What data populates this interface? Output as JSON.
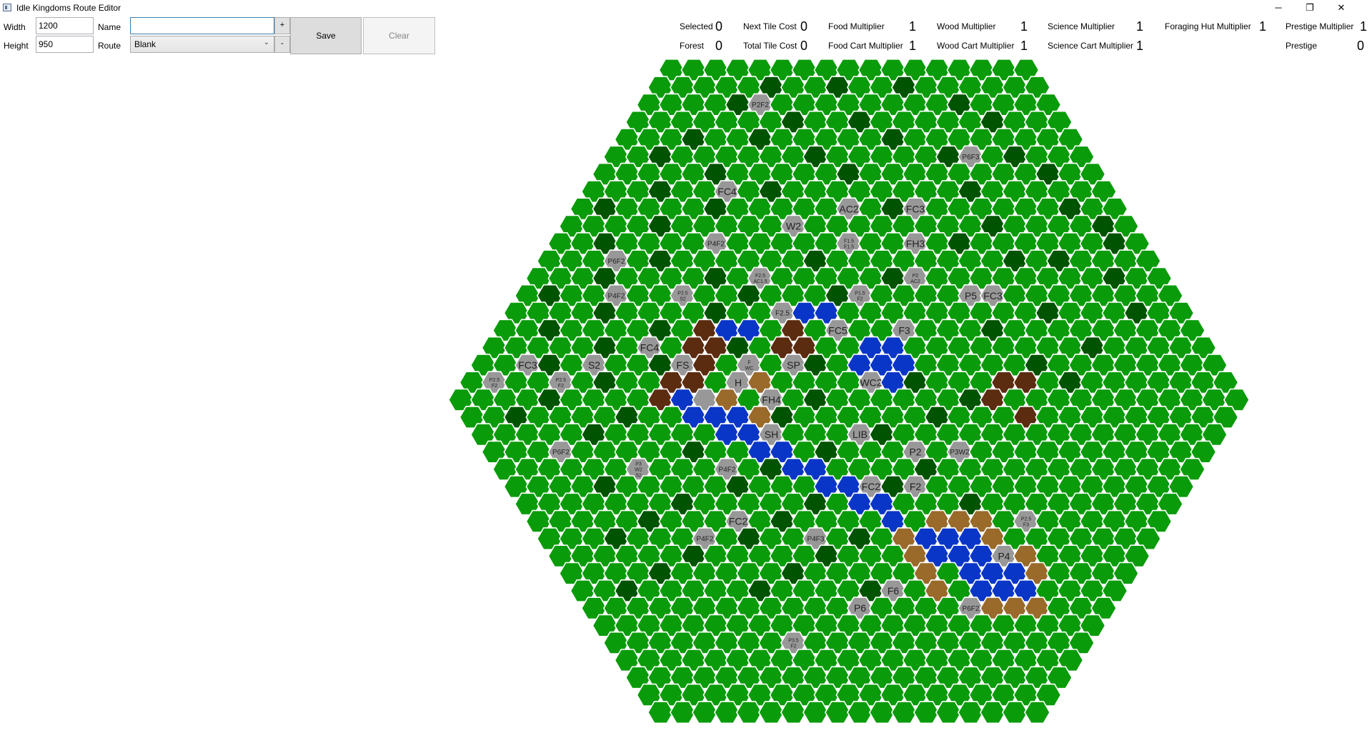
{
  "window": {
    "title": "Idle Kingdoms Route Editor",
    "minimize": "─",
    "restore": "❐",
    "close": "✕"
  },
  "toolbar": {
    "width_label": "Width",
    "width_value": "1200",
    "height_label": "Height",
    "height_value": "950",
    "name_label": "Name",
    "name_value": "",
    "route_label": "Route",
    "route_value": "Blank",
    "add_label": "+",
    "remove_label": "-",
    "save_label": "Save",
    "clear_label": "Clear"
  },
  "stats": {
    "selected": {
      "label": "Selected",
      "value": "0"
    },
    "forest": {
      "label": "Forest",
      "value": "0"
    },
    "next_tile_cost": {
      "label": "Next Tile Cost",
      "value": "0"
    },
    "total_tile_cost": {
      "label": "Total Tile Cost",
      "value": "0"
    },
    "food_multiplier": {
      "label": "Food Multiplier",
      "value": "1"
    },
    "food_cart_multiplier": {
      "label": "Food Cart Multiplier",
      "value": "1"
    },
    "wood_multiplier": {
      "label": "Wood Multiplier",
      "value": "1"
    },
    "wood_cart_multiplier": {
      "label": "Wood Cart Multiplier",
      "value": "1"
    },
    "science_multiplier": {
      "label": "Science Multiplier",
      "value": "1"
    },
    "science_cart_multiplier": {
      "label": "Science Cart Multiplier",
      "value": "1"
    },
    "foraging_hut_multiplier": {
      "label": "Foraging Hut Multiplier",
      "value": "1"
    },
    "prestige_multiplier": {
      "label": "Prestige Multiplier",
      "value": "1"
    },
    "prestige": {
      "label": "Prestige",
      "value": "0"
    }
  },
  "map": {
    "colors": {
      "grass": "#0a9b0a",
      "forest": "#005300",
      "water": "#0a36c8",
      "mountain": "#5c2c10",
      "sand": "#9a6a2a",
      "special": "#989898",
      "stroke": "#ffffff",
      "label": "#222222"
    },
    "forest_cells": [
      [
        1,
        5
      ],
      [
        1,
        8
      ],
      [
        1,
        11
      ],
      [
        2,
        4
      ],
      [
        2,
        14
      ],
      [
        3,
        7
      ],
      [
        3,
        10
      ],
      [
        3,
        16
      ],
      [
        4,
        3
      ],
      [
        4,
        6
      ],
      [
        4,
        12
      ],
      [
        5,
        2
      ],
      [
        5,
        9
      ],
      [
        5,
        15
      ],
      [
        5,
        18
      ],
      [
        6,
        5
      ],
      [
        6,
        11
      ],
      [
        6,
        20
      ],
      [
        7,
        3
      ],
      [
        7,
        8
      ],
      [
        7,
        17
      ],
      [
        8,
        1
      ],
      [
        8,
        6
      ],
      [
        8,
        14
      ],
      [
        8,
        22
      ],
      [
        9,
        4
      ],
      [
        9,
        10
      ],
      [
        9,
        19
      ],
      [
        9,
        24
      ],
      [
        10,
        2
      ],
      [
        10,
        7
      ],
      [
        10,
        13
      ],
      [
        10,
        18
      ],
      [
        10,
        25
      ],
      [
        11,
        5
      ],
      [
        11,
        12
      ],
      [
        11,
        21
      ],
      [
        11,
        23
      ],
      [
        12,
        3
      ],
      [
        12,
        8
      ],
      [
        12,
        16
      ],
      [
        12,
        26
      ],
      [
        13,
        1
      ],
      [
        13,
        10
      ],
      [
        13,
        14
      ],
      [
        13,
        20
      ],
      [
        14,
        4
      ],
      [
        14,
        9
      ],
      [
        14,
        24
      ],
      [
        14,
        28
      ],
      [
        15,
        2
      ],
      [
        15,
        7
      ],
      [
        15,
        13
      ],
      [
        15,
        22
      ],
      [
        16,
        5
      ],
      [
        16,
        11
      ],
      [
        16,
        18
      ],
      [
        16,
        27
      ],
      [
        17,
        3
      ],
      [
        17,
        8
      ],
      [
        17,
        15
      ],
      [
        17,
        25
      ],
      [
        18,
        1
      ],
      [
        18,
        6
      ],
      [
        18,
        12
      ],
      [
        18,
        20
      ],
      [
        18,
        27
      ],
      [
        19,
        4
      ],
      [
        19,
        9
      ],
      [
        19,
        16
      ],
      [
        19,
        23
      ],
      [
        20,
        2
      ],
      [
        20,
        7
      ],
      [
        20,
        14
      ],
      [
        20,
        21
      ],
      [
        21,
        5
      ],
      [
        21,
        11
      ],
      [
        21,
        18
      ],
      [
        22,
        3
      ],
      [
        22,
        9
      ],
      [
        22,
        15
      ],
      [
        22,
        21
      ],
      [
        23,
        6
      ],
      [
        23,
        12
      ],
      [
        23,
        19
      ],
      [
        24,
        4
      ],
      [
        24,
        10
      ],
      [
        24,
        17
      ],
      [
        25,
        7
      ],
      [
        25,
        13
      ],
      [
        25,
        20
      ],
      [
        26,
        5
      ],
      [
        26,
        11
      ],
      [
        26,
        16
      ],
      [
        27,
        3
      ],
      [
        27,
        9
      ],
      [
        27,
        14
      ],
      [
        28,
        6
      ],
      [
        28,
        12
      ],
      [
        29,
        4
      ],
      [
        29,
        10
      ],
      [
        30,
        2
      ],
      [
        30,
        8
      ],
      [
        30,
        13
      ]
    ],
    "water_cells": [
      [
        14,
        12
      ],
      [
        14,
        13
      ],
      [
        14,
        14
      ],
      [
        15,
        10
      ],
      [
        15,
        11
      ],
      [
        16,
        17
      ],
      [
        16,
        18
      ],
      [
        17,
        17
      ],
      [
        17,
        18
      ],
      [
        17,
        19
      ],
      [
        18,
        18
      ],
      [
        18,
        19
      ],
      [
        19,
        10
      ],
      [
        20,
        10
      ],
      [
        20,
        11
      ],
      [
        20,
        12
      ],
      [
        21,
        11
      ],
      [
        21,
        12
      ],
      [
        21,
        13
      ],
      [
        22,
        12
      ],
      [
        22,
        13
      ],
      [
        23,
        13
      ],
      [
        23,
        14
      ],
      [
        24,
        14
      ],
      [
        24,
        15
      ],
      [
        25,
        15
      ],
      [
        25,
        16
      ],
      [
        26,
        16
      ],
      [
        27,
        17
      ],
      [
        27,
        18
      ],
      [
        27,
        19
      ],
      [
        28,
        17
      ],
      [
        28,
        18
      ],
      [
        28,
        19
      ],
      [
        28,
        20
      ],
      [
        29,
        18
      ],
      [
        29,
        19
      ],
      [
        29,
        20
      ],
      [
        30,
        18
      ],
      [
        30,
        19
      ],
      [
        30,
        20
      ]
    ],
    "mountain_cells": [
      [
        15,
        9
      ],
      [
        15,
        13
      ],
      [
        16,
        9
      ],
      [
        16,
        10
      ],
      [
        16,
        13
      ],
      [
        16,
        14
      ],
      [
        17,
        9
      ],
      [
        17,
        10
      ],
      [
        17,
        14
      ],
      [
        18,
        9
      ],
      [
        18,
        10
      ],
      [
        19,
        9
      ],
      [
        18,
        24
      ],
      [
        18,
        25
      ],
      [
        19,
        24
      ],
      [
        20,
        25
      ]
    ],
    "sand_cells": [
      [
        18,
        13
      ],
      [
        19,
        12
      ],
      [
        20,
        13
      ],
      [
        26,
        18
      ],
      [
        26,
        19
      ],
      [
        26,
        20
      ],
      [
        27,
        16
      ],
      [
        27,
        20
      ],
      [
        28,
        16
      ],
      [
        28,
        21
      ],
      [
        29,
        16
      ],
      [
        29,
        21
      ],
      [
        30,
        16
      ],
      [
        31,
        17
      ],
      [
        31,
        18
      ],
      [
        31,
        19
      ],
      [
        31,
        20
      ]
    ],
    "special_tiles": [
      {
        "r": 2,
        "c": 5,
        "label": "P2F2"
      },
      {
        "r": 5,
        "c": 16,
        "label": "P6F3"
      },
      {
        "r": 7,
        "c": 6,
        "label": "FC4"
      },
      {
        "r": 8,
        "c": 12,
        "label": "AC2"
      },
      {
        "r": 8,
        "c": 15,
        "label": "FC3"
      },
      {
        "r": 9,
        "c": 10,
        "label": "W2"
      },
      {
        "r": 10,
        "c": 7,
        "label": "P4F2"
      },
      {
        "r": 10,
        "c": 13,
        "label": "F1.5 F1.5"
      },
      {
        "r": 10,
        "c": 16,
        "label": "FH3"
      },
      {
        "r": 11,
        "c": 3,
        "label": "P6F2"
      },
      {
        "r": 12,
        "c": 10,
        "label": "F2.5 AC1.5"
      },
      {
        "r": 12,
        "c": 17,
        "label": "P2 AC2"
      },
      {
        "r": 13,
        "c": 4,
        "label": "P4F2"
      },
      {
        "r": 13,
        "c": 7,
        "label": "P2.5 S2"
      },
      {
        "r": 13,
        "c": 15,
        "label": "P1.5 F2"
      },
      {
        "r": 13,
        "c": 20,
        "label": "P5"
      },
      {
        "r": 13,
        "c": 21,
        "label": "FC3"
      },
      {
        "r": 14,
        "c": 12,
        "label": "F2.5"
      },
      {
        "r": 15,
        "c": 15,
        "label": "FC5"
      },
      {
        "r": 15,
        "c": 18,
        "label": "F3"
      },
      {
        "r": 16,
        "c": 7,
        "label": "FC4"
      },
      {
        "r": 17,
        "c": 2,
        "label": "FC3"
      },
      {
        "r": 17,
        "c": 9,
        "label": "FS"
      },
      {
        "r": 17,
        "c": 12,
        "label": "F WC"
      },
      {
        "r": 17,
        "c": 14,
        "label": "SP"
      },
      {
        "r": 17,
        "c": 5,
        "label": "S2"
      },
      {
        "r": 18,
        "c": 1,
        "label": "P2.5 F2"
      },
      {
        "r": 18,
        "c": 4,
        "label": "P2.5 F2"
      },
      {
        "r": 18,
        "c": 12,
        "label": "H"
      },
      {
        "r": 18,
        "c": 18,
        "label": "WC2"
      },
      {
        "r": 19,
        "c": 11,
        "label": ""
      },
      {
        "r": 19,
        "c": 14,
        "label": "FH4"
      },
      {
        "r": 21,
        "c": 13,
        "label": "SH"
      },
      {
        "r": 21,
        "c": 17,
        "label": "LIB"
      },
      {
        "r": 22,
        "c": 3,
        "label": "P6F2"
      },
      {
        "r": 22,
        "c": 19,
        "label": "P2"
      },
      {
        "r": 22,
        "c": 21,
        "label": "P3W2"
      },
      {
        "r": 23,
        "c": 6,
        "label": "P3 W2 S2"
      },
      {
        "r": 23,
        "c": 10,
        "label": "P4F2"
      },
      {
        "r": 24,
        "c": 16,
        "label": "FC2"
      },
      {
        "r": 24,
        "c": 18,
        "label": "F2"
      },
      {
        "r": 26,
        "c": 9,
        "label": "FC2"
      },
      {
        "r": 26,
        "c": 22,
        "label": "P2.5 F3"
      },
      {
        "r": 27,
        "c": 7,
        "label": "P4F2"
      },
      {
        "r": 27,
        "c": 12,
        "label": "P4F3"
      },
      {
        "r": 28,
        "c": 20,
        "label": "P4"
      },
      {
        "r": 30,
        "c": 14,
        "label": "F6"
      },
      {
        "r": 31,
        "c": 12,
        "label": "P6"
      },
      {
        "r": 31,
        "c": 17,
        "label": "P6F2"
      },
      {
        "r": 33,
        "c": 8,
        "label": "P3.5 F2"
      }
    ]
  }
}
